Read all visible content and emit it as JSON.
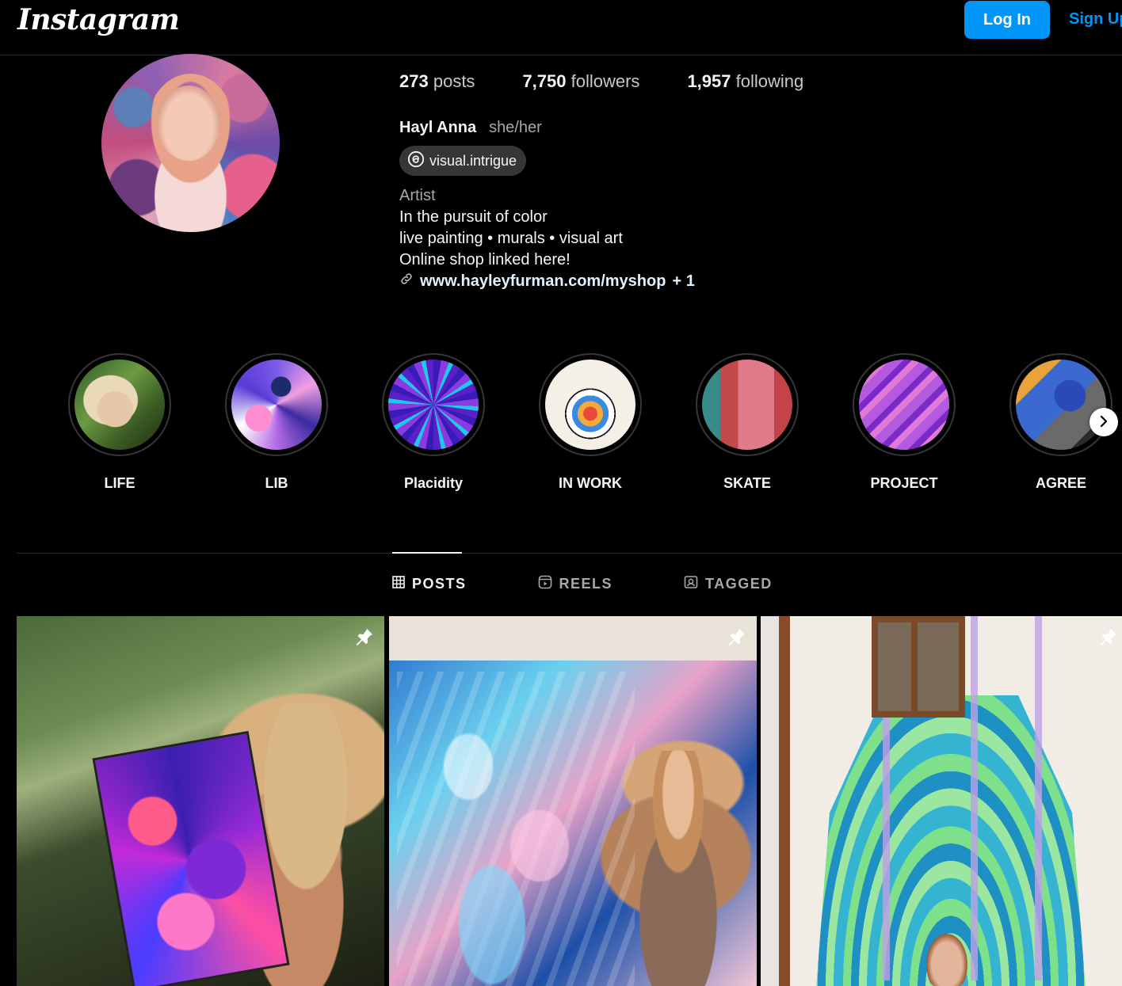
{
  "topbar": {
    "logo": "Instagram",
    "login_label": "Log In",
    "signup_label": "Sign Up"
  },
  "profile": {
    "stats": {
      "posts_count": "273",
      "posts_label": "posts",
      "followers_count": "7,750",
      "followers_label": "followers",
      "following_count": "1,957",
      "following_label": "following"
    },
    "name": "Hayl Anna",
    "pronouns": "she/her",
    "threads_handle": "visual.intrigue",
    "category": "Artist",
    "bio_lines": [
      "In the pursuit of color",
      "live painting • murals • visual art",
      "Online shop linked here!"
    ],
    "link": "www.hayleyfurman.com/myshop",
    "link_extra": "+ 1"
  },
  "highlights": [
    {
      "label": "LIFE"
    },
    {
      "label": "LIB"
    },
    {
      "label": "Placidity"
    },
    {
      "label": "IN WORK"
    },
    {
      "label": "SKATE"
    },
    {
      "label": "PROJECT"
    },
    {
      "label": "AGREE"
    }
  ],
  "tabs": [
    {
      "label": "POSTS",
      "icon": "grid-icon",
      "active": true
    },
    {
      "label": "REELS",
      "icon": "reels-icon",
      "active": false
    },
    {
      "label": "TAGGED",
      "icon": "tagged-icon",
      "active": false
    }
  ],
  "posts": [
    {
      "pinned": true
    },
    {
      "pinned": true
    },
    {
      "pinned": true
    }
  ],
  "colors": {
    "accent": "#0095f6",
    "background": "#000000",
    "divider": "#262626"
  }
}
